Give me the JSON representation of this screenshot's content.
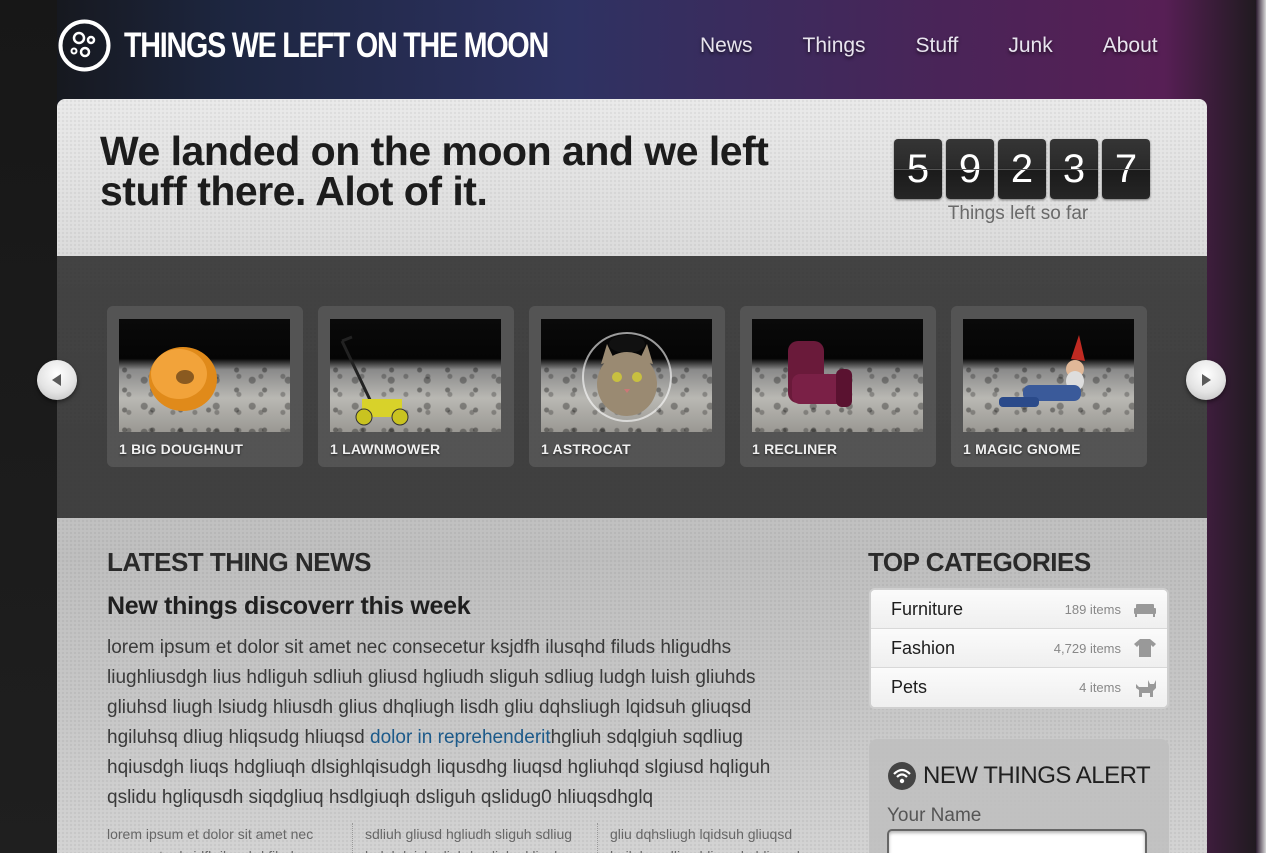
{
  "site": {
    "logo_text": "THINGS WE LEFT ON THE MOON"
  },
  "nav": [
    {
      "label": "News"
    },
    {
      "label": "Things"
    },
    {
      "label": "Stuff"
    },
    {
      "label": "Junk"
    },
    {
      "label": "About"
    }
  ],
  "hero": {
    "title": "We landed on the moon and we left stuff there. Alot of it.",
    "counter_digits": [
      "5",
      "9",
      "2",
      "3",
      "7"
    ],
    "counter_label": "Things left so far"
  },
  "carousel": {
    "items": [
      {
        "label": "1 BIG DOUGHNUT",
        "icon": "doughnut"
      },
      {
        "label": "1 LAWNMOWER",
        "icon": "lawnmower"
      },
      {
        "label": "1 ASTROCAT",
        "icon": "astrocat"
      },
      {
        "label": "1 RECLINER",
        "icon": "recliner"
      },
      {
        "label": "1 MAGIC GNOME",
        "icon": "gnome"
      }
    ]
  },
  "news": {
    "heading": "LATEST THING NEWS",
    "subheading": "New things discoverr this week",
    "body_before": "lorem ipsum et dolor sit amet nec consecetur ksjdfh ilusqhd filuds hligudhs liughliusdgh lius hdliguh sdliuh gliusd hgliudh sliguh sdliug ludgh luish gliuhds gliuhsd liugh lsiudg hliusdh glius dhqliugh lisdh gliu dqhsliugh lqidsuh gliuqsd hgiluhsq dliug hliqsudg hliuqsd ",
    "link_text": "dolor in reprehenderit",
    "body_after": "hgliuh sdqlgiuh sqdliug hqiusdgh liuqs hdgliuqh dlsighlqisudgh liqusdhg liuqsd hgliuhqd slgiusd hqliguh qslidu hgliqusdh siqdgliuq hsdlgiuqh dsliguh qslidug0 hliuqsdhglq",
    "columns": [
      "lorem ipsum et dolor sit amet nec consecetur ksjdfh ilusqhd filuds",
      "sdliuh gliusd hgliudh sliguh sdliug ludgh luish gliuhds gliuhsd liugh",
      "gliu dqhsliugh lqidsuh gliuqsd hgiluhsq dliug hliqsudg hliuqsd"
    ]
  },
  "categories": {
    "heading": "TOP CATEGORIES",
    "items": [
      {
        "name": "Furniture",
        "count": "189 items",
        "icon": "sofa-icon"
      },
      {
        "name": "Fashion",
        "count": "4,729 items",
        "icon": "tshirt-icon"
      },
      {
        "name": "Pets",
        "count": "4 items",
        "icon": "cat-icon"
      }
    ]
  },
  "alert": {
    "title": "NEW THINGS ALERT",
    "name_label": "Your Name",
    "name_value": ""
  }
}
